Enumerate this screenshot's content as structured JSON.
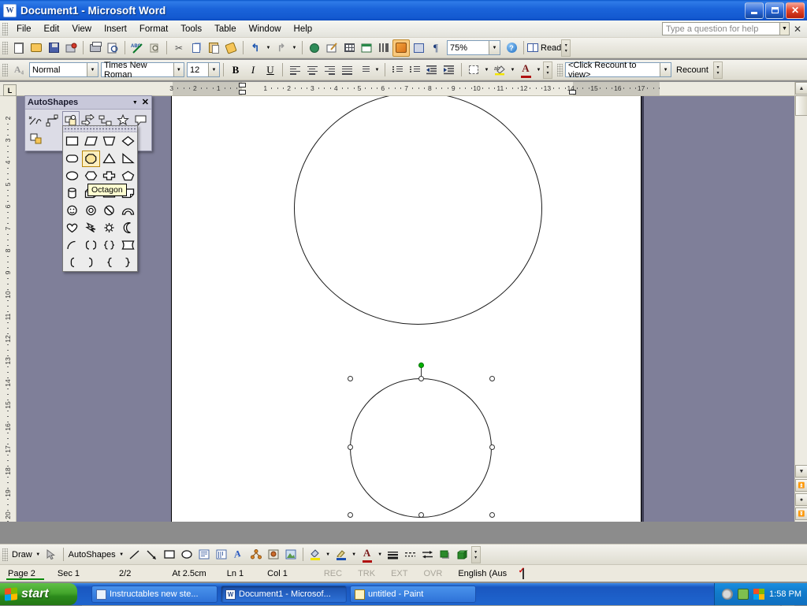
{
  "window": {
    "title": "Document1 - Microsoft Word",
    "app_icon": "word-icon",
    "minimize_label": "Minimize",
    "maximize_label": "Restore",
    "close_label": "Close"
  },
  "menus": [
    {
      "label": "File",
      "accel": "F"
    },
    {
      "label": "Edit",
      "accel": "E"
    },
    {
      "label": "View",
      "accel": "V"
    },
    {
      "label": "Insert",
      "accel": "I"
    },
    {
      "label": "Format",
      "accel": "o"
    },
    {
      "label": "Tools",
      "accel": "T"
    },
    {
      "label": "Table",
      "accel": "a"
    },
    {
      "label": "Window",
      "accel": "W"
    },
    {
      "label": "Help",
      "accel": "H"
    }
  ],
  "ask_help": {
    "placeholder": "Type a question for help",
    "value": "Type a question for help",
    "dropdown_icon": "chevron-down-icon",
    "close_icon": "close-icon"
  },
  "standard_toolbar": {
    "buttons": [
      {
        "name": "new-blank-document",
        "icon": "page-icon"
      },
      {
        "name": "open",
        "icon": "folder-icon"
      },
      {
        "name": "save",
        "icon": "floppy-icon"
      },
      {
        "name": "permission",
        "icon": "permission-icon"
      },
      {
        "name": "print",
        "icon": "printer-icon"
      },
      {
        "name": "print-preview",
        "icon": "preview-icon"
      },
      {
        "name": "spelling-and-grammar",
        "icon": "abc-check-icon"
      },
      {
        "name": "research",
        "icon": "research-icon"
      },
      {
        "name": "cut",
        "icon": "scissors-icon"
      },
      {
        "name": "copy",
        "icon": "copy-icon"
      },
      {
        "name": "paste",
        "icon": "clipboard-icon"
      },
      {
        "name": "format-painter",
        "icon": "paintbrush-icon"
      },
      {
        "name": "undo",
        "icon": "undo-arrow-icon"
      },
      {
        "name": "redo",
        "icon": "redo-arrow-icon"
      },
      {
        "name": "insert-hyperlink",
        "icon": "globe-icon"
      },
      {
        "name": "tables-and-borders",
        "icon": "table-pencil-icon"
      },
      {
        "name": "insert-table",
        "icon": "table-icon"
      },
      {
        "name": "insert-excel-worksheet",
        "icon": "excel-sheet-icon"
      },
      {
        "name": "columns",
        "icon": "columns-icon"
      },
      {
        "name": "drawing",
        "icon": "drawing-icon"
      },
      {
        "name": "document-map",
        "icon": "document-map-icon"
      },
      {
        "name": "show-formatting-marks",
        "icon": "pilcrow-icon"
      },
      {
        "name": "microsoft-word-help",
        "icon": "help-icon"
      },
      {
        "name": "read",
        "icon": "book-icon"
      }
    ],
    "zoom_value": "75%",
    "read_label": "Read",
    "overflow_icon": "toolbar-options-icon"
  },
  "formatting_toolbar": {
    "style_value": "Normal",
    "font_value": "Times New Roman",
    "size_value": "12",
    "buttons": [
      {
        "name": "styles-and-formatting",
        "icon": "style-a-icon"
      },
      {
        "name": "bold",
        "icon": "bold-icon",
        "label": "B"
      },
      {
        "name": "italic",
        "icon": "italic-icon",
        "label": "I"
      },
      {
        "name": "underline",
        "icon": "underline-icon",
        "label": "U"
      },
      {
        "name": "align-left",
        "icon": "align-left-icon"
      },
      {
        "name": "align-center",
        "icon": "align-center-icon"
      },
      {
        "name": "align-right",
        "icon": "align-right-icon"
      },
      {
        "name": "justify",
        "icon": "justify-icon"
      },
      {
        "name": "line-spacing",
        "icon": "line-spacing-icon"
      },
      {
        "name": "numbering",
        "icon": "numbered-list-icon"
      },
      {
        "name": "bullets",
        "icon": "bulleted-list-icon"
      },
      {
        "name": "decrease-indent",
        "icon": "decrease-indent-icon"
      },
      {
        "name": "increase-indent",
        "icon": "increase-indent-icon"
      },
      {
        "name": "outside-border",
        "icon": "border-icon"
      },
      {
        "name": "highlight",
        "icon": "highlight-icon"
      },
      {
        "name": "font-color",
        "icon": "font-color-icon"
      }
    ]
  },
  "word_count_toolbar": {
    "value": "<Click Recount to view>",
    "recount_label": "Recount",
    "recount_accel": "c",
    "dropdown_icon": "chevron-down-icon",
    "overflow_icon": "toolbar-options-icon"
  },
  "autoshapes_panel": {
    "title": "AutoShapes",
    "options_icon": "chevron-down-icon",
    "close_icon": "close-icon",
    "categories": [
      {
        "name": "lines",
        "label": "Lines"
      },
      {
        "name": "connectors",
        "label": "Connectors"
      },
      {
        "name": "basic-shapes",
        "label": "Basic Shapes",
        "selected": true
      },
      {
        "name": "block-arrows",
        "label": "Block Arrows"
      },
      {
        "name": "flowchart",
        "label": "Flowchart"
      },
      {
        "name": "stars-and-banners",
        "label": "Stars and Banners"
      },
      {
        "name": "callouts",
        "label": "Callouts"
      },
      {
        "name": "more-autoshapes",
        "label": "More AutoShapes"
      }
    ]
  },
  "basic_shapes_flyout": {
    "tooltip": "Octagon",
    "selected_shape": "octagon",
    "shapes": [
      [
        "rectangle",
        "parallelogram",
        "trapezoid",
        "diamond"
      ],
      [
        "rounded-rectangle",
        "octagon",
        "isosceles-triangle",
        "right-triangle"
      ],
      [
        "oval",
        "hexagon",
        "cross",
        "regular-pentagon"
      ],
      [
        "can",
        "cube",
        "bevel",
        "folded-corner"
      ],
      [
        "smiley-face",
        "donut",
        "no-symbol",
        "block-arc"
      ],
      [
        "heart",
        "lightning-bolt",
        "sun",
        "moon"
      ],
      [
        "arc",
        "double-bracket",
        "double-brace",
        "plaque"
      ],
      [
        "left-bracket",
        "right-bracket",
        "left-brace",
        "right-brace"
      ]
    ]
  },
  "rulers": {
    "horizontal_unit": "cm",
    "horizontal_numbers": [
      "3",
      "2",
      "1",
      "1",
      "2",
      "3",
      "4",
      "5",
      "6",
      "7",
      "8",
      "9",
      "10",
      "11",
      "12",
      "13",
      "14",
      "15",
      "16",
      "17"
    ],
    "vertical_numbers": [
      "2",
      "3",
      "4",
      "5",
      "6",
      "7",
      "8",
      "9",
      "10",
      "11",
      "12",
      "13",
      "14",
      "15",
      "16",
      "17",
      "18",
      "19",
      "20"
    ],
    "tab_stop_icon": "left-tab-icon"
  },
  "document": {
    "shapes": [
      {
        "name": "circle-top",
        "type": "oval",
        "selected": false
      },
      {
        "name": "circle-bottom",
        "type": "oval",
        "selected": true
      }
    ],
    "selection_handles": 8,
    "rotation_handle_color": "#00B200"
  },
  "view_buttons": [
    {
      "name": "normal-view",
      "icon": "normal-view-icon",
      "active": false
    },
    {
      "name": "web-layout-view",
      "icon": "web-layout-icon",
      "active": false
    },
    {
      "name": "print-layout-view",
      "icon": "print-layout-icon",
      "active": true
    },
    {
      "name": "outline-view",
      "icon": "outline-view-icon",
      "active": false
    },
    {
      "name": "reading-layout-view",
      "icon": "reading-layout-icon",
      "active": false
    }
  ],
  "drawing_toolbar": {
    "draw_label": "Draw",
    "draw_accel": "D",
    "autoshapes_label": "AutoShapes",
    "autoshapes_accel": "u",
    "buttons": [
      {
        "name": "select-objects",
        "icon": "arrow-pointer-icon"
      },
      {
        "name": "line",
        "icon": "line-icon"
      },
      {
        "name": "arrow",
        "icon": "arrow-icon"
      },
      {
        "name": "rectangle",
        "icon": "rectangle-icon"
      },
      {
        "name": "oval",
        "icon": "oval-icon"
      },
      {
        "name": "text-box",
        "icon": "textbox-icon"
      },
      {
        "name": "vertical-text-box",
        "icon": "vertical-textbox-icon"
      },
      {
        "name": "insert-wordart",
        "icon": "wordart-icon"
      },
      {
        "name": "insert-diagram",
        "icon": "diagram-icon"
      },
      {
        "name": "insert-clip-art",
        "icon": "clipart-icon"
      },
      {
        "name": "insert-picture",
        "icon": "picture-icon"
      },
      {
        "name": "fill-color",
        "icon": "fill-bucket-icon"
      },
      {
        "name": "line-color",
        "icon": "line-color-pen-icon"
      },
      {
        "name": "font-color",
        "icon": "font-color-icon"
      },
      {
        "name": "line-style",
        "icon": "line-style-icon"
      },
      {
        "name": "dash-style",
        "icon": "dash-style-icon"
      },
      {
        "name": "arrow-style",
        "icon": "arrow-style-icon"
      },
      {
        "name": "shadow-style",
        "icon": "shadow-style-icon"
      },
      {
        "name": "3d-style",
        "icon": "3d-style-icon"
      }
    ]
  },
  "status_bar": {
    "page": "Page  2",
    "section": "Sec  1",
    "pages": "2/2",
    "at": "At 2.5cm",
    "line": "Ln  1",
    "col": "Col  1",
    "rec": "REC",
    "trk": "TRK",
    "ext": "EXT",
    "ovr": "OVR",
    "language": "English (Aus",
    "spell_icon": "spelling-status-icon"
  },
  "taskbar": {
    "start_label": "start",
    "items": [
      {
        "name": "taskbar-item-ie",
        "label": "Instructables new ste...",
        "icon": "ie-icon",
        "active": false
      },
      {
        "name": "taskbar-item-word",
        "label": "Document1 - Microsof...",
        "icon": "word-icon",
        "active": true
      },
      {
        "name": "taskbar-item-paint",
        "label": "untitled - Paint",
        "icon": "paint-icon",
        "active": false
      }
    ],
    "tray_icons": [
      "volume-icon",
      "network-icon",
      "office-icon"
    ],
    "clock": "1:58 PM"
  }
}
